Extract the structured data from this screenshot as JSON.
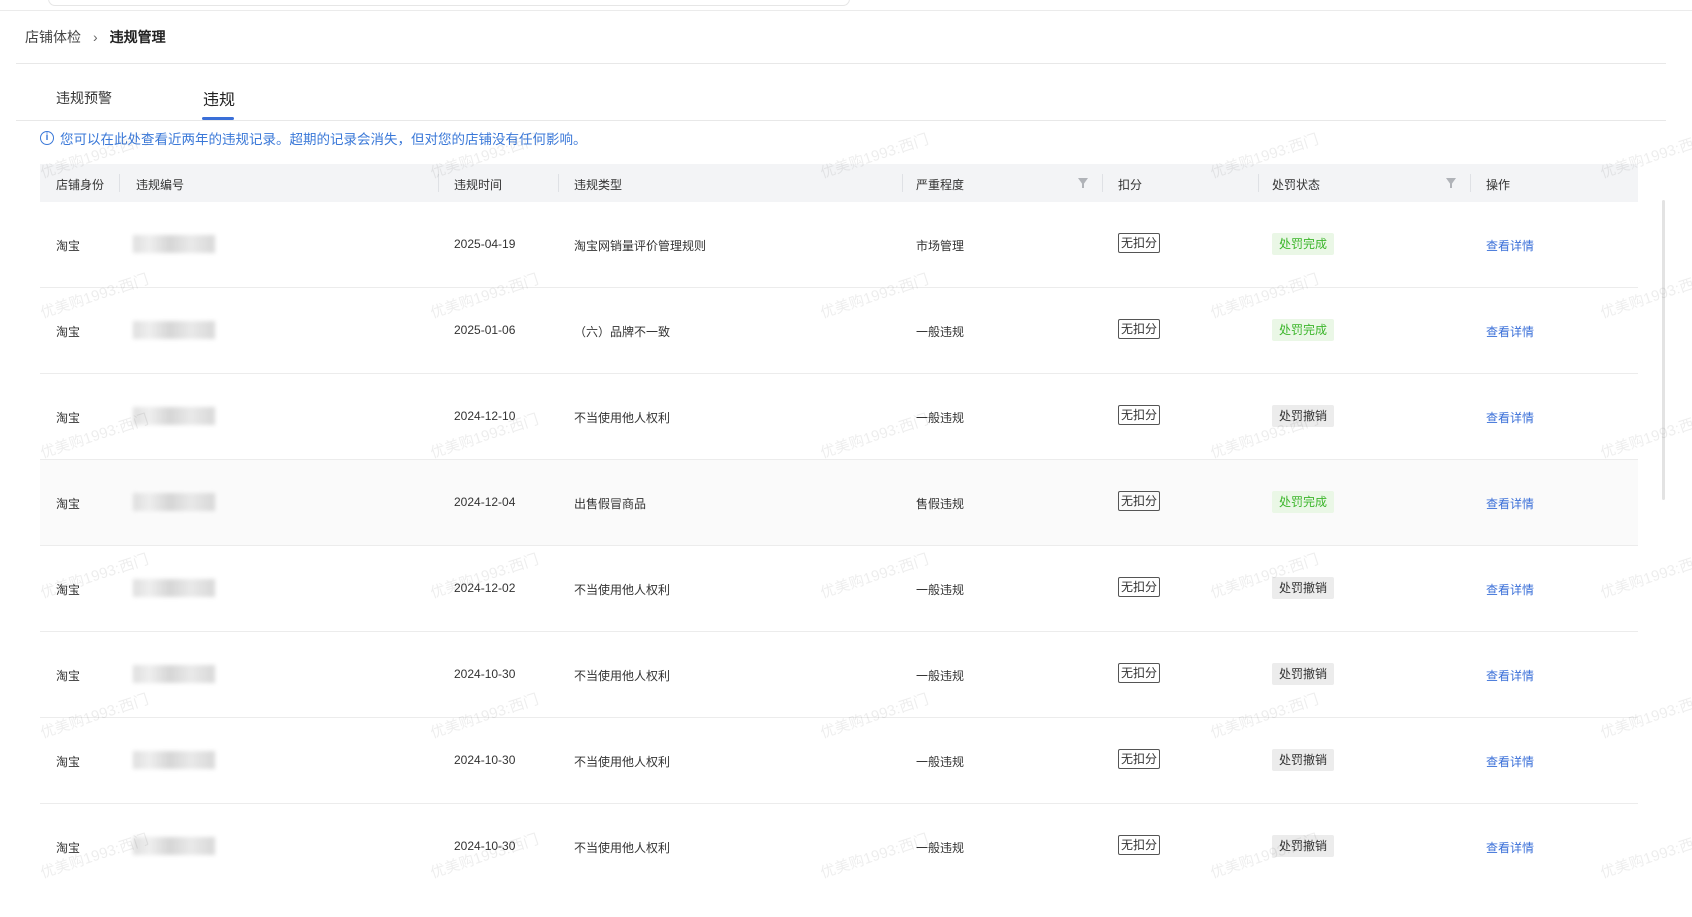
{
  "breadcrumb": {
    "parent": "店铺体检",
    "separator": "›",
    "current": "违规管理"
  },
  "tabs": [
    {
      "label": "违规预警",
      "active": false
    },
    {
      "label": "违规",
      "active": true
    }
  ],
  "notice": {
    "icon": "info-icon",
    "text": "您可以在此处查看近两年的违规记录。超期的记录会消失，但对您的店铺没有任何影响。"
  },
  "table": {
    "headers": {
      "shop_identity": "店铺身份",
      "violation_no": "违规编号",
      "violation_time": "违规时间",
      "violation_type": "违规类型",
      "severity": "严重程度",
      "deduction": "扣分",
      "penalty_status": "处罚状态",
      "action": "操作"
    },
    "rows": [
      {
        "shop": "淘宝",
        "number": "",
        "date": "2025-04-19",
        "type": "淘宝网销量评价管理规则",
        "severity": "市场管理",
        "deduction": "无扣分",
        "status": "处罚完成",
        "status_kind": "done",
        "action": "查看详情"
      },
      {
        "shop": "淘宝",
        "number": "",
        "date": "2025-01-06",
        "type": "（六）品牌不一致",
        "severity": "一般违规",
        "deduction": "无扣分",
        "status": "处罚完成",
        "status_kind": "done",
        "action": "查看详情"
      },
      {
        "shop": "淘宝",
        "number": "",
        "date": "2024-12-10",
        "type": "不当使用他人权利",
        "severity": "一般违规",
        "deduction": "无扣分",
        "status": "处罚撤销",
        "status_kind": "revoked",
        "action": "查看详情"
      },
      {
        "shop": "淘宝",
        "number": "",
        "date": "2024-12-04",
        "type": "出售假冒商品",
        "severity": "售假违规",
        "deduction": "无扣分",
        "status": "处罚完成",
        "status_kind": "done",
        "action": "查看详情"
      },
      {
        "shop": "淘宝",
        "number": "",
        "date": "2024-12-02",
        "type": "不当使用他人权利",
        "severity": "一般违规",
        "deduction": "无扣分",
        "status": "处罚撤销",
        "status_kind": "revoked",
        "action": "查看详情"
      },
      {
        "shop": "淘宝",
        "number": "",
        "date": "2024-10-30",
        "type": "不当使用他人权利",
        "severity": "一般违规",
        "deduction": "无扣分",
        "status": "处罚撤销",
        "status_kind": "revoked",
        "action": "查看详情"
      },
      {
        "shop": "淘宝",
        "number": "",
        "date": "2024-10-30",
        "type": "不当使用他人权利",
        "severity": "一般违规",
        "deduction": "无扣分",
        "status": "处罚撤销",
        "status_kind": "revoked",
        "action": "查看详情"
      },
      {
        "shop": "淘宝",
        "number": "",
        "date": "2024-10-30",
        "type": "不当使用他人权利",
        "severity": "一般违规",
        "deduction": "无扣分",
        "status": "处罚撤销",
        "status_kind": "revoked",
        "action": "查看详情"
      }
    ]
  },
  "watermark_text": "优美购1993:西门",
  "colors": {
    "accent": "#3a6fd8",
    "status_done_bg": "#eaf7e6",
    "status_done_fg": "#3cb62b",
    "status_revoked_bg": "#ececec"
  }
}
